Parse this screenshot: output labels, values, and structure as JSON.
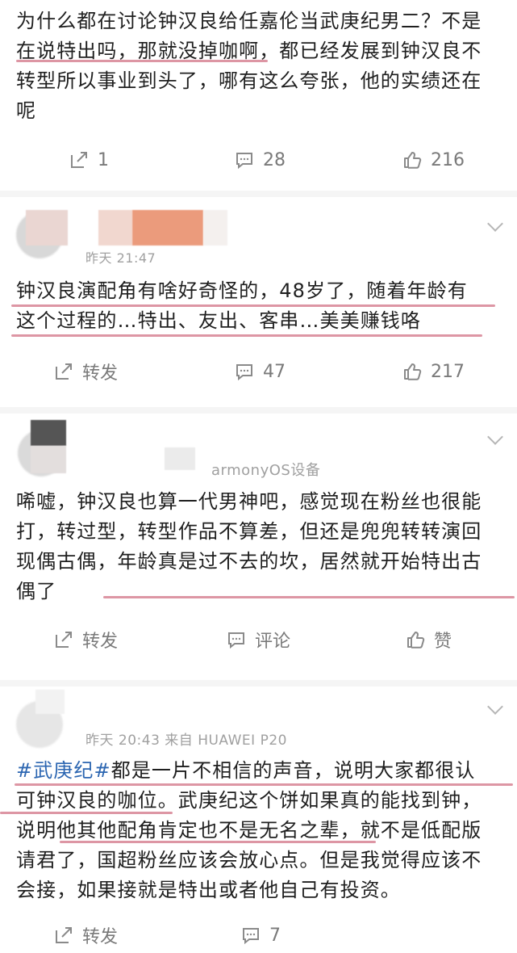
{
  "posts": [
    {
      "meta": "",
      "text_lines": [
        "为什么都在讨论钟汉良给任嘉伦当武庚纪男二？不是",
        "在说特出吗，那就没掉咖啊，都已经发展到钟汉良不",
        "转型所以事业到头了，哪有这么夸张，他的实绩还在",
        "呢"
      ],
      "actions": {
        "share": "1",
        "comment": "28",
        "like": "216"
      }
    },
    {
      "meta": "昨天 21:47",
      "text_lines": [
        "钟汉良演配角有啥好奇怪的，48岁了，随着年龄有",
        "这个过程的…特出、友出、客串…美美赚钱咯"
      ],
      "actions": {
        "share": "转发",
        "comment": "47",
        "like": "217"
      }
    },
    {
      "meta": "armonyOS设备",
      "text_lines": [
        "唏嘘，钟汉良也算一代男神吧，感觉现在粉丝也很能",
        "打，转过型，转型作品不算差，但还是兜兜转转演回",
        "现偶古偶，年龄真是过不去的坎，居然就开始特出古",
        "偶了"
      ],
      "actions": {
        "share": "转发",
        "comment": "评论",
        "like": "赞"
      }
    },
    {
      "meta": "昨天 20:43  来自 HUAWEI P20",
      "hashtag": "#武庚纪#",
      "text_lines": [
        "都是一片不相信的声音，说明大家都很认",
        "可钟汉良的咖位。武庚纪这个饼如果真的能找到钟，",
        "说明他其他配角肯定也不是无名之辈，就不是低配版",
        "请君了，国超粉丝应该会放心点。但是我觉得应该不",
        "会接，如果接就是特出或者他自己有投资。"
      ],
      "actions": {
        "share": "转发",
        "comment": "7",
        "like": ""
      }
    }
  ],
  "icons": {
    "share": "share-icon",
    "comment": "comment-icon",
    "like": "thumbs-up-icon",
    "more": "chevron-down-icon"
  },
  "colors": {
    "hashtag": "#2c66b1",
    "highlight": "#d98b9a",
    "muted": "#7a7a7a"
  }
}
